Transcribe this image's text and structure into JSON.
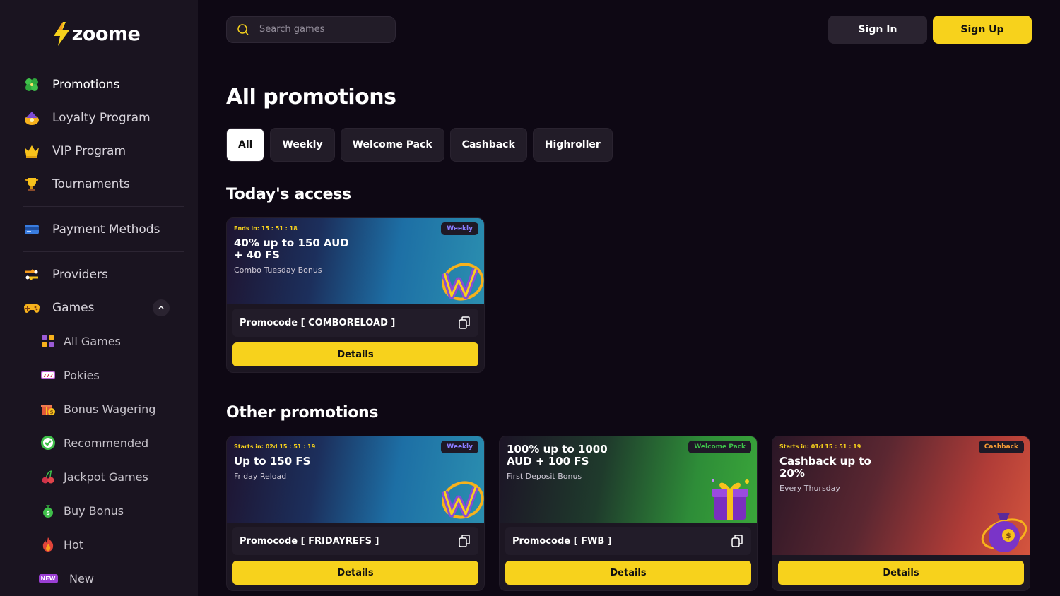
{
  "brand": {
    "name": "zoome",
    "accent": "#f7d21c"
  },
  "sidebar": {
    "main_items": [
      {
        "label": "Promotions",
        "icon": "clover-icon"
      },
      {
        "label": "Loyalty Program",
        "icon": "loyalty-icon"
      },
      {
        "label": "VIP Program",
        "icon": "crown-icon"
      },
      {
        "label": "Tournaments",
        "icon": "trophy-icon"
      }
    ],
    "payment": {
      "label": "Payment Methods",
      "icon": "card-icon"
    },
    "providers": {
      "label": "Providers",
      "icon": "providers-icon"
    },
    "games": {
      "label": "Games",
      "icon": "gamepad-icon"
    },
    "game_items": [
      {
        "label": "All Games",
        "icon": "grid-icon"
      },
      {
        "label": "Pokies",
        "icon": "slot-icon"
      },
      {
        "label": "Bonus Wagering",
        "icon": "gift-icon"
      },
      {
        "label": "Recommended",
        "icon": "check-icon"
      },
      {
        "label": "Jackpot Games",
        "icon": "cherry-icon"
      },
      {
        "label": "Buy Bonus",
        "icon": "money-bag-icon"
      },
      {
        "label": "Hot",
        "icon": "fire-icon"
      },
      {
        "label": "New",
        "icon": "new-badge-icon",
        "badge": "NEW"
      }
    ]
  },
  "header": {
    "search_placeholder": "Search games",
    "sign_in": "Sign In",
    "sign_up": "Sign Up"
  },
  "page": {
    "title": "All promotions",
    "filters": [
      "All",
      "Weekly",
      "Welcome Pack",
      "Cashback",
      "Highroller"
    ],
    "today_title": "Today's access",
    "other_title": "Other promotions"
  },
  "today_cards": [
    {
      "countdown": "Ends in: 15 : 51 : 18",
      "badge": "Weekly",
      "title": "40% up to 150 AUD + 40 FS",
      "subtitle": "Combo Tuesday Bonus",
      "promocode": "Promocode [ COMBORELOAD ]",
      "details": "Details"
    }
  ],
  "other_cards": [
    {
      "countdown": "Starts in: 02d 15 : 51 : 19",
      "badge": "Weekly",
      "title": "Up to 150 FS",
      "subtitle": "Friday Reload",
      "promocode": "Promocode [ FRIDAYREFS ]",
      "details": "Details"
    },
    {
      "countdown": "",
      "badge": "Welcome Pack",
      "title": "100% up to 1000 AUD + 100 FS",
      "subtitle": "First Deposit Bonus",
      "promocode": "Promocode [ FWB ]",
      "details": "Details"
    },
    {
      "countdown": "Starts in: 01d 15 : 51 : 19",
      "badge": "Cashback",
      "title": "Cashback up to 20%",
      "subtitle": "Every Thursday",
      "details": "Details"
    }
  ]
}
